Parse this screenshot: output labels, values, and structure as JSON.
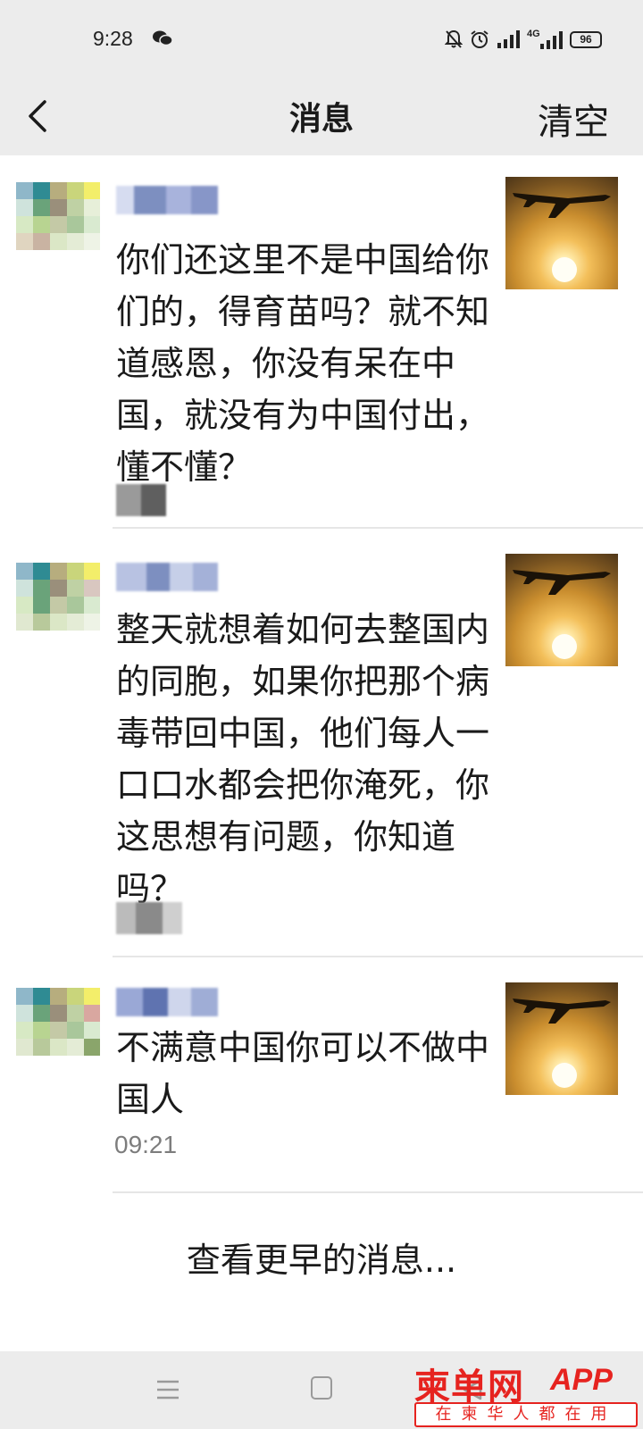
{
  "status_bar": {
    "time": "9:28",
    "battery": "96",
    "network": "4G",
    "icons": [
      "wechat-icon",
      "mute-bell-icon",
      "alarm-icon",
      "signal-icon",
      "signal-4g-icon",
      "battery-icon"
    ]
  },
  "nav": {
    "title": "消息",
    "clear_label": "清空",
    "back_icon": "chevron-left-icon"
  },
  "messages": [
    {
      "text": "你们还这里不是中国给你们的，得育苗吗？就不知道感恩，你没有呆在中国，就没有为中国付出，懂不懂？",
      "time": ""
    },
    {
      "text": "整天就想着如何去整国内的同胞，如果你把那个病毒带回中国，他们每人一口口水都会把你淹死，你这思想有问题，你知道吗？",
      "time": ""
    },
    {
      "text": "不满意中国你可以不做中国人",
      "time": "09:21"
    }
  ],
  "load_more": "查看更早的消息...",
  "watermark": {
    "main": "柬单网",
    "app": "APP",
    "sub": "在柬华人都在用"
  },
  "colors": {
    "bar_bg": "#ececec",
    "text": "#1a1a1a",
    "time": "#7d7d7d",
    "watermark_red": "#e6231f"
  }
}
